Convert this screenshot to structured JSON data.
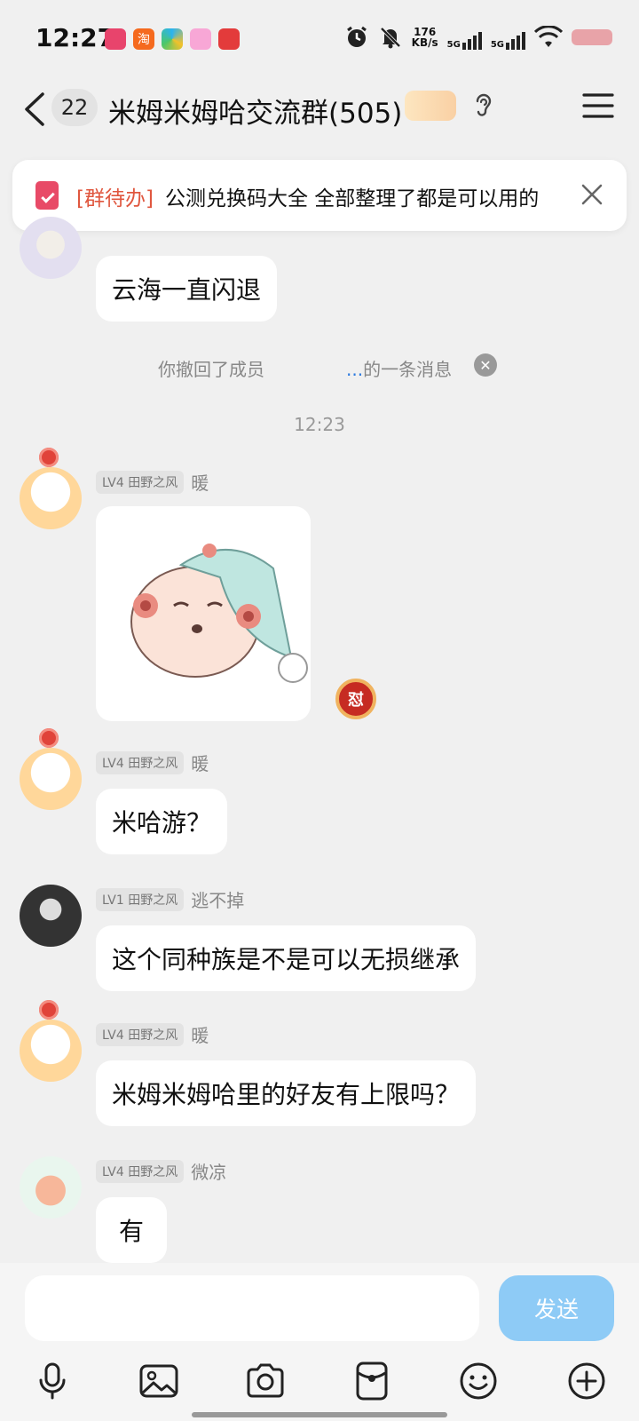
{
  "status_bar": {
    "time": "12:27",
    "net_speed_value": "176",
    "net_speed_unit": "KB/s",
    "signal_1": "5G",
    "signal_2": "5G",
    "app_icons": [
      "app-icon-1",
      "taobao-icon",
      "app-icon-3",
      "crown-app-icon",
      "app-icon-5"
    ],
    "taobao_glyph": "淘"
  },
  "header": {
    "unread_count": "22",
    "title": "米姆米姆哈交流群(505)"
  },
  "todo": {
    "tag": "[群待办]",
    "text": "公测兑换码大全 全部整理了都是可以用的"
  },
  "messages": [
    {
      "level": "",
      "name": "",
      "text": "云海一直闪退"
    },
    {
      "level": "LV4 田野之风",
      "name": "暖",
      "type": "sticker",
      "reaction": "怼"
    },
    {
      "level": "LV4 田野之风",
      "name": "暖",
      "text": "米哈游？"
    },
    {
      "level": "LV1 田野之风",
      "name": "逃不掉",
      "text": "这个同种族是不是可以无损继承"
    },
    {
      "level": "LV4 田野之风",
      "name": "暖",
      "text": "米姆米姆哈里的好友有上限吗？"
    },
    {
      "level": "LV4 田野之风",
      "name": "微凉",
      "text": "有"
    }
  ],
  "system": {
    "recall_prefix": "你撤回了成员",
    "recall_dots": "...",
    "recall_suffix": "的一条消息",
    "timestamp": "12:23"
  },
  "input": {
    "placeholder": "",
    "send_label": "发送"
  },
  "colors": {
    "accent": "#8ecbf6",
    "todo_tag": "#e0573f",
    "todo_icon": "#e84a67"
  }
}
